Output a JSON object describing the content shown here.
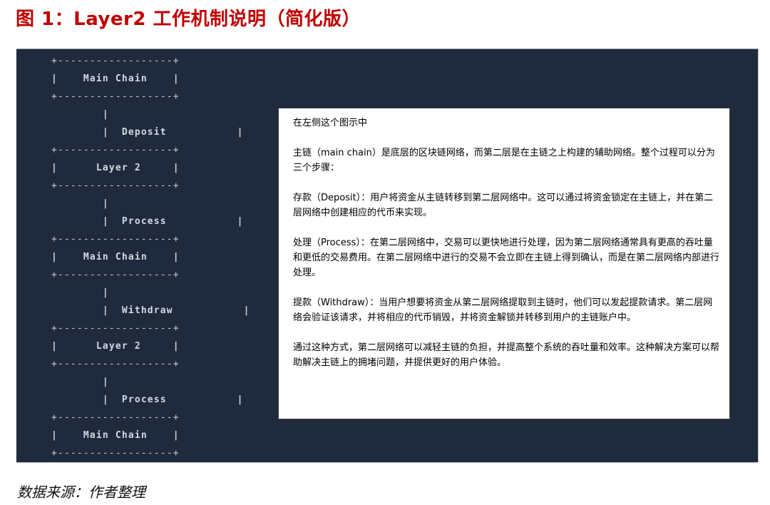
{
  "figure": {
    "title": "图 1：Layer2 工作机制说明（简化版）",
    "source": "数据来源：作者整理"
  },
  "diagram": {
    "lines": [
      {
        "kind": "border",
        "text": "+------------------+"
      },
      {
        "kind": "node",
        "text": "|    Main Chain    |",
        "label": "Main Chain"
      },
      {
        "kind": "border",
        "text": "+------------------+"
      },
      {
        "kind": "pipe",
        "text": "        |"
      },
      {
        "kind": "edge",
        "text": "        |  Deposit           |",
        "label": "Deposit"
      },
      {
        "kind": "border",
        "text": "+------------------+"
      },
      {
        "kind": "node",
        "text": "|      Layer 2     |",
        "label": "Layer 2"
      },
      {
        "kind": "border",
        "text": "+------------------+"
      },
      {
        "kind": "pipe",
        "text": "        |"
      },
      {
        "kind": "edge",
        "text": "        |  Process           |",
        "label": "Process"
      },
      {
        "kind": "border",
        "text": "+------------------+"
      },
      {
        "kind": "node",
        "text": "|    Main Chain    |",
        "label": "Main Chain"
      },
      {
        "kind": "border",
        "text": "+------------------+"
      },
      {
        "kind": "pipe",
        "text": "        |"
      },
      {
        "kind": "edge",
        "text": "        |  Withdraw           |",
        "label": "Withdraw"
      },
      {
        "kind": "border",
        "text": "+------------------+"
      },
      {
        "kind": "node",
        "text": "|      Layer 2     |",
        "label": "Layer 2"
      },
      {
        "kind": "border",
        "text": "+------------------+"
      },
      {
        "kind": "pipe",
        "text": "        |"
      },
      {
        "kind": "edge",
        "text": "        |  Process           |",
        "label": "Process"
      },
      {
        "kind": "border",
        "text": "+------------------+"
      },
      {
        "kind": "node",
        "text": "|    Main Chain    |",
        "label": "Main Chain"
      },
      {
        "kind": "border",
        "text": "+------------------+"
      }
    ]
  },
  "explanation": {
    "paragraphs": [
      "在左侧这个图示中",
      "主链（main chain）是底层的区块链网络，而第二层是在主链之上构建的辅助网络。整个过程可以分为三个步骤：",
      "存款（Deposit）：用户将资金从主链转移到第二层网络中。这可以通过将资金锁定在主链上，并在第二层网络中创建相应的代币来实现。",
      "处理（Process）：在第二层网络中，交易可以更快地进行处理，因为第二层网络通常具有更高的吞吐量和更低的交易费用。在第二层网络中进行的交易不会立即在主链上得到确认，而是在第二层网络内部进行处理。",
      "提款（Withdraw）：当用户想要将资金从第二层网络提取到主链时，他们可以发起提款请求。第二层网络会验证该请求，并将相应的代币销毁，并将资金解锁并转移到用户的主链账户中。",
      "通过这种方式，第二层网络可以减轻主链的负担，并提高整个系统的吞吐量和效率。这种解决方案可以帮助解决主链上的拥堵问题，并提供更好的用户体验。"
    ]
  },
  "colors": {
    "title": "#c00000",
    "panel_background": "#1f2a3c",
    "ascii_text": "#d6dae2"
  }
}
